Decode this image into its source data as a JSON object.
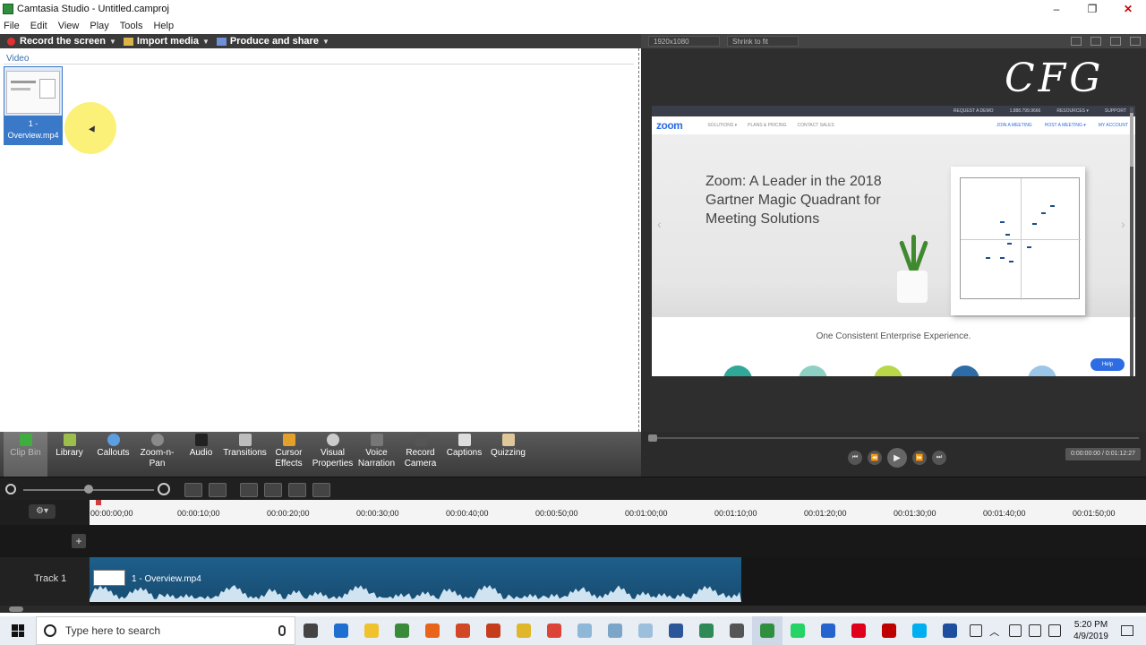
{
  "window": {
    "title": "Camtasia Studio - Untitled.camproj",
    "minimize": "–",
    "maximize": "❐",
    "close": "✕"
  },
  "menu": [
    "File",
    "Edit",
    "View",
    "Play",
    "Tools",
    "Help"
  ],
  "toolbar": {
    "record": "Record the screen",
    "import": "Import media",
    "produce": "Produce and share"
  },
  "clip_bin": {
    "section_label": "Video",
    "clip_name": "1 - Overview.mp4"
  },
  "preview": {
    "dimensions": "1920x1080",
    "zoom": "Shrink to fit",
    "logo_text": "CFG",
    "website": {
      "top_links": [
        "REQUEST A DEMO",
        "1.888.799.9666",
        "RESOURCES ▾",
        "SUPPORT"
      ],
      "logo": "zoom",
      "nav_links": [
        "SOLUTIONS ▾",
        "PLANS & PRICING",
        "CONTACT SALES"
      ],
      "nav_right": [
        "JOIN A MEETING",
        "HOST A MEETING ▾",
        "MY ACCOUNT"
      ],
      "headline": "Zoom: A Leader in the 2018 Gartner Magic Quadrant for Meeting Solutions",
      "subheadline": "One Consistent Enterprise Experience.",
      "help_button": "Help"
    },
    "time_display": "0:00:00:00 / 0:01:12:27"
  },
  "tasks": [
    {
      "label": "Clip Bin",
      "color": "#3fae3f"
    },
    {
      "label": "Library",
      "color": "#9bbf4a"
    },
    {
      "label": "Callouts",
      "color": "#5d9ee0"
    },
    {
      "label": "Zoom-n-Pan",
      "color": "#8a8a8a"
    },
    {
      "label": "Audio",
      "color": "#222222"
    },
    {
      "label": "Transitions",
      "color": "#bdbdbd"
    },
    {
      "label": "Cursor Effects",
      "color": "#e3a02a"
    },
    {
      "label": "Visual Properties",
      "color": "#cccccc"
    },
    {
      "label": "Voice Narration",
      "color": "#777777"
    },
    {
      "label": "Record Camera",
      "color": "#555555"
    },
    {
      "label": "Captions",
      "color": "#dddddd"
    },
    {
      "label": "Quizzing",
      "color": "#e0c79a"
    }
  ],
  "timeline": {
    "ticks": [
      "00:00:00;00",
      "00:00:10;00",
      "00:00:20;00",
      "00:00:30;00",
      "00:00:40;00",
      "00:00:50;00",
      "00:01:00;00",
      "00:01:10;00",
      "00:01:20;00",
      "00:01:30;00",
      "00:01:40;00",
      "00:01:50;00"
    ],
    "track_name": "Track 1",
    "clip_name": "1 - Overview.mp4",
    "add_track": "+"
  },
  "taskbar": {
    "search_placeholder": "Type here to search",
    "time": "5:20 PM",
    "date": "4/9/2019",
    "apps": [
      {
        "name": "task-view",
        "color": "#444444"
      },
      {
        "name": "edge",
        "color": "#1f6fd0"
      },
      {
        "name": "file-explorer",
        "color": "#f0c22e"
      },
      {
        "name": "camtasia-recorder",
        "color": "#3a8a3a"
      },
      {
        "name": "firefox",
        "color": "#e8641b"
      },
      {
        "name": "powerpoint",
        "color": "#d24726"
      },
      {
        "name": "powerpoint-2",
        "color": "#c43e1c"
      },
      {
        "name": "chrome",
        "color": "#e0b62a"
      },
      {
        "name": "chrome-2",
        "color": "#db4437"
      },
      {
        "name": "notepad",
        "color": "#8fb8d8"
      },
      {
        "name": "notepad-2",
        "color": "#7ca6c8"
      },
      {
        "name": "notepad-3",
        "color": "#9cc0dc"
      },
      {
        "name": "word",
        "color": "#2b579a"
      },
      {
        "name": "remote-app",
        "color": "#2e8b57"
      },
      {
        "name": "calculator",
        "color": "#555555"
      },
      {
        "name": "camtasia-studio",
        "color": "#2f8f3f"
      },
      {
        "name": "whatsapp",
        "color": "#25d366"
      },
      {
        "name": "todo",
        "color": "#2564cf"
      },
      {
        "name": "opera",
        "color": "#e0001b"
      },
      {
        "name": "filezilla",
        "color": "#bf0000"
      },
      {
        "name": "skype",
        "color": "#00aff0"
      },
      {
        "name": "screen-app",
        "color": "#1e4e9e"
      }
    ]
  }
}
